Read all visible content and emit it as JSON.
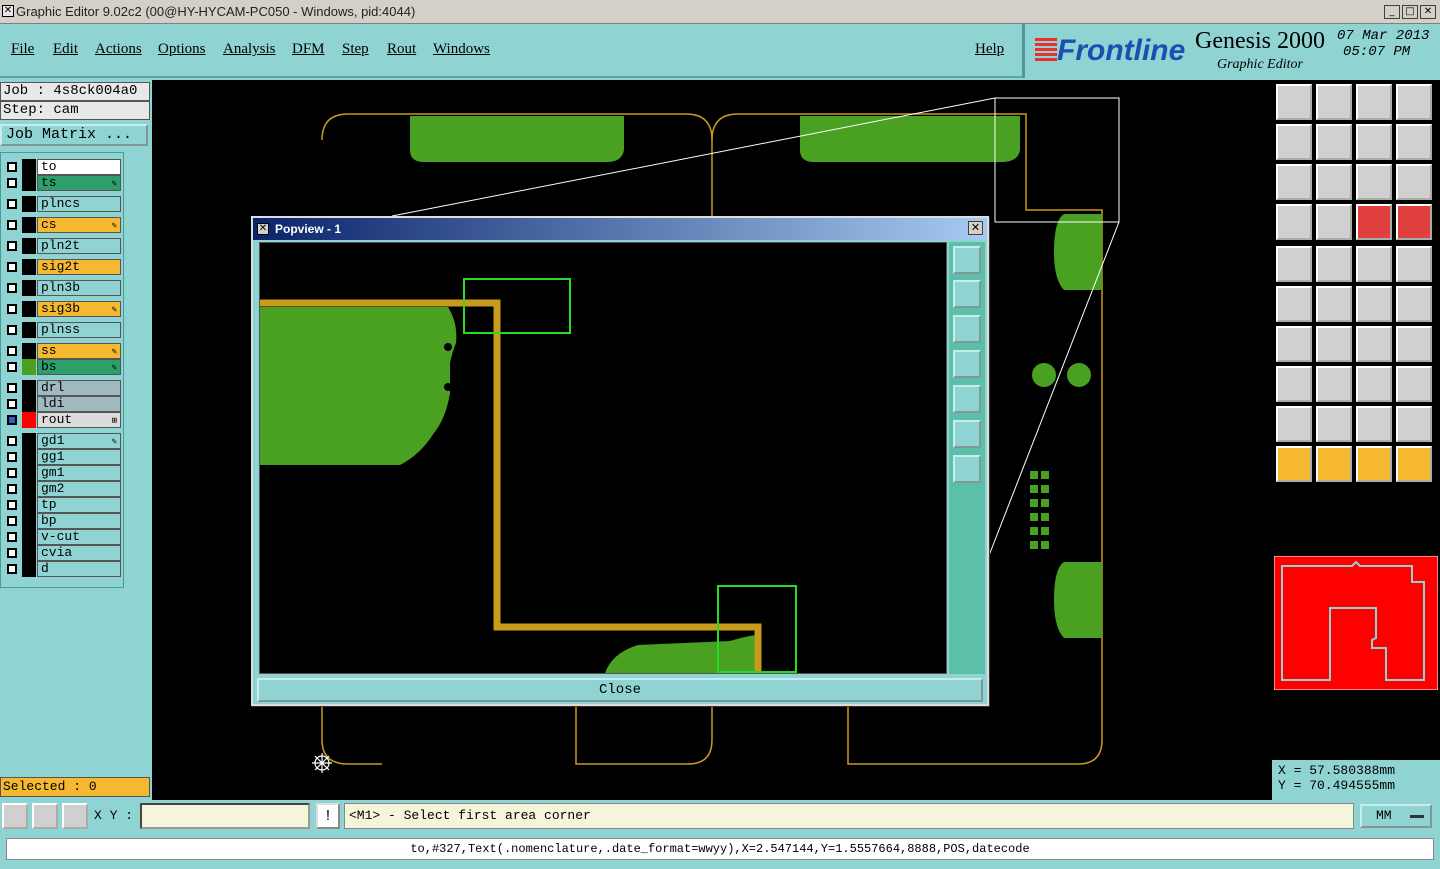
{
  "window": {
    "title": "Graphic Editor 9.02c2 (00@HY-HYCAM-PC050 - Windows, pid:4044)"
  },
  "menu": {
    "items": [
      {
        "label": "File"
      },
      {
        "label": "Edit"
      },
      {
        "label": "Actions"
      },
      {
        "label": "Options"
      },
      {
        "label": "Analysis"
      },
      {
        "label": "DFM"
      },
      {
        "label": "Step"
      },
      {
        "label": "Rout"
      },
      {
        "label": "Windows"
      },
      {
        "label": "Help"
      }
    ]
  },
  "brand": {
    "logo": "Frontline",
    "product": "Genesis 2000",
    "subtitle": "Graphic Editor",
    "date": "07  Mar  2013",
    "time": "05:07  PM"
  },
  "job": {
    "job_line": "Job : 4s8ck004a0",
    "step_line": "Step: cam",
    "matrix_button": "Job Matrix ..."
  },
  "layers": [
    {
      "name": "to",
      "color": "#ffffff",
      "swatch": "#000000"
    },
    {
      "name": "ts",
      "color": "#2e9e6a",
      "swatch": "#000000",
      "flag": "✎"
    },
    {
      "name": "plncs",
      "color": "#8fd3d3",
      "swatch": "#000000"
    },
    {
      "name": "cs",
      "color": "#f5b830",
      "swatch": "#000000",
      "flag": "✎"
    },
    {
      "name": "pln2t",
      "color": "#8fd3d3",
      "swatch": "#000000"
    },
    {
      "name": "sig2t",
      "color": "#f5b830",
      "swatch": "#000000"
    },
    {
      "name": "pln3b",
      "color": "#8fd3d3",
      "swatch": "#000000"
    },
    {
      "name": "sig3b",
      "color": "#f5b830",
      "swatch": "#000000",
      "flag": "✎"
    },
    {
      "name": "plnss",
      "color": "#8fd3d3",
      "swatch": "#000000"
    },
    {
      "name": "ss",
      "color": "#f5b830",
      "swatch": "#000000",
      "flag": "✎"
    },
    {
      "name": "bs",
      "color": "#2e9e6a",
      "swatch": "#4aa020",
      "flag": "✎"
    },
    {
      "name": "drl",
      "color": "#a0b8c0",
      "swatch": "#000000"
    },
    {
      "name": "ldi",
      "color": "#a0b8c0",
      "swatch": "#000000"
    },
    {
      "name": "rout",
      "color": "#dcdcdc",
      "swatch": "#ff0000",
      "flag": "⊞"
    },
    {
      "name": "gd1",
      "color": "#8fd3d3",
      "swatch": "#000000",
      "flag": "✎"
    },
    {
      "name": "gg1",
      "color": "#8fd3d3",
      "swatch": "#000000"
    },
    {
      "name": "gm1",
      "color": "#8fd3d3",
      "swatch": "#000000"
    },
    {
      "name": "gm2",
      "color": "#8fd3d3",
      "swatch": "#000000"
    },
    {
      "name": "tp",
      "color": "#8fd3d3",
      "swatch": "#000000"
    },
    {
      "name": "bp",
      "color": "#8fd3d3",
      "swatch": "#000000"
    },
    {
      "name": "v-cut",
      "color": "#8fd3d3",
      "swatch": "#000000"
    },
    {
      "name": "cvia",
      "color": "#8fd3d3",
      "swatch": "#000000"
    },
    {
      "name": "d",
      "color": "#8fd3d3",
      "swatch": "#000000"
    }
  ],
  "selected": "Selected : 0",
  "popview": {
    "title": "Popview - 1",
    "close_label": "Close"
  },
  "coords": {
    "x": "X  =  57.580388mm",
    "y": "Y  =  70.494555mm"
  },
  "input": {
    "xy_label": "X Y :",
    "xy_value": "",
    "prompt": "<M1> - Select first area corner",
    "unit": "MM"
  },
  "status": "to,#327,Text(.nomenclature,.date_format=wwyy),X=2.547144,Y=1.5557664,8888,POS,datecode",
  "colors": {
    "panel": "#8fd3d3",
    "copper": "#4aa020",
    "trace": "#c89b1a",
    "outline": "#c89b1a",
    "highlight": "#f5b830",
    "rout": "#ff0000"
  }
}
